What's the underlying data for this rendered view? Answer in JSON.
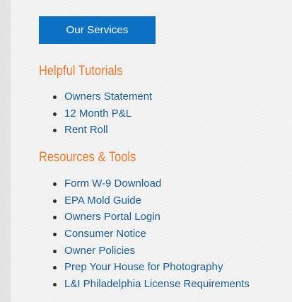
{
  "services_button": {
    "label": "Our Services"
  },
  "tutorials": {
    "heading": "Helpful Tutorials",
    "items": [
      "Owners Statement",
      "12 Month P&L",
      "Rent Roll"
    ]
  },
  "resources": {
    "heading": "Resources & Tools",
    "items": [
      "Form W-9 Download",
      "EPA Mold Guide",
      "Owners Portal Login",
      "Consumer Notice",
      "Owner Policies",
      "Prep Your House for Photography",
      "L&I Philadelphia License Requirements"
    ]
  },
  "colors": {
    "button_bg": "#0a72c0",
    "heading": "#e9782c",
    "link": "#1c5c8f",
    "panel_bg": "#f3f3f3",
    "page_bg": "#e3e3e3"
  }
}
